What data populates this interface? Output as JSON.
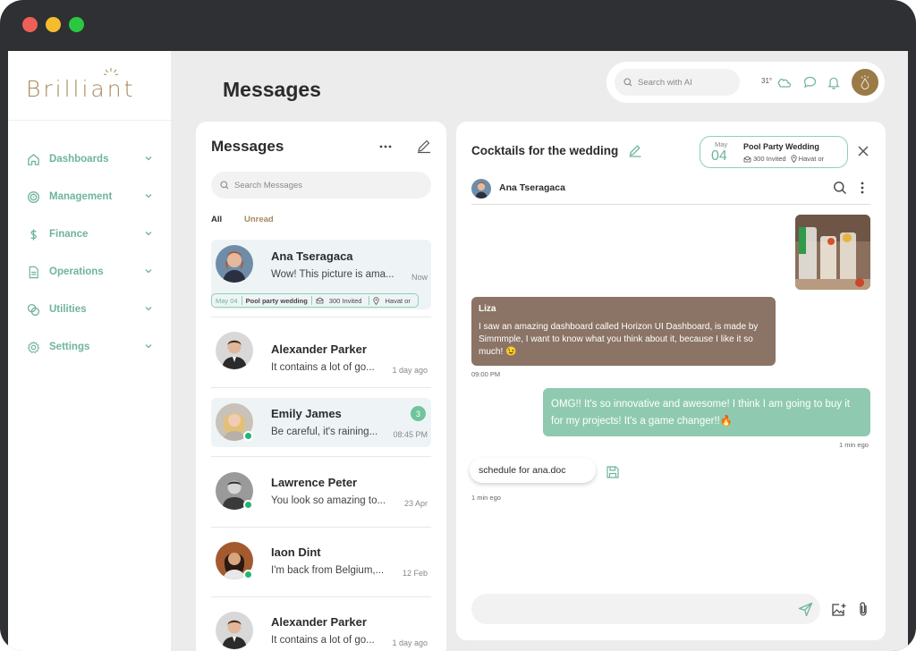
{
  "app": {
    "logo_text": "Brilliant"
  },
  "colors": {
    "accent_green": "#6fb49b",
    "brand_gold": "#a68a5c",
    "incoming_bubble": "#8b7465",
    "outgoing_bubble": "#8fcab0"
  },
  "sidebar": {
    "items": [
      {
        "label": "Dashboards",
        "icon": "home-icon"
      },
      {
        "label": "Management",
        "icon": "target-icon"
      },
      {
        "label": "Finance",
        "icon": "dollar-icon"
      },
      {
        "label": "Operations",
        "icon": "document-icon"
      },
      {
        "label": "Utilities",
        "icon": "circles-icon"
      },
      {
        "label": "Settings",
        "icon": "gear-icon"
      }
    ]
  },
  "header": {
    "title": "Messages",
    "search_placeholder": "Search with AI",
    "weather": "31°"
  },
  "list": {
    "title": "Messages",
    "search_placeholder": "Search Messages",
    "tabs": {
      "all": "All",
      "unread": "Unread"
    },
    "conversations": [
      {
        "name": "Ana Tseragaca",
        "preview": "Wow! This picture is ama...",
        "time": "Now",
        "tag": {
          "date": "May 04",
          "event": "Pool party wedding",
          "invited": "300 Invited",
          "location": "Havat or"
        }
      },
      {
        "name": "Alexander Parker",
        "preview": "It contains a lot of go...",
        "time": "1 day ago"
      },
      {
        "name": "Emily James",
        "preview": "Be careful, it's raining...",
        "time": "08:45 PM",
        "unread": "3"
      },
      {
        "name": "Lawrence Peter",
        "preview": "You look so amazing to...",
        "time": "23 Apr"
      },
      {
        "name": "Iaon Dint",
        "preview": "I'm back from Belgium,...",
        "time": "12 Feb"
      },
      {
        "name": "Alexander Parker",
        "preview": "It contains a lot of go...",
        "time": "1 day ago"
      }
    ]
  },
  "chat": {
    "title": "Cocktails for the wedding",
    "event": {
      "month": "May",
      "day": "04",
      "title": "Pool Party Wedding",
      "invited": "300 Invited",
      "location": "Havat or"
    },
    "user": "Ana Tseragaca",
    "messages": {
      "incoming": {
        "sender": "Liza",
        "text": "I saw an amazing dashboard called Horizon UI Dashboard, is made by Simmmple, I want to know what you think about it, because I like it so much! 😉",
        "time": "09:00 PM"
      },
      "outgoing": {
        "text": "OMG!! It's so innovative and awesome! I think I am going to buy it for my projects! It's a game changer!!🔥",
        "time": "1 min ego"
      },
      "file": {
        "name": "schedule for ana.doc",
        "time": "1 min ego"
      }
    },
    "composer_placeholder": ""
  }
}
